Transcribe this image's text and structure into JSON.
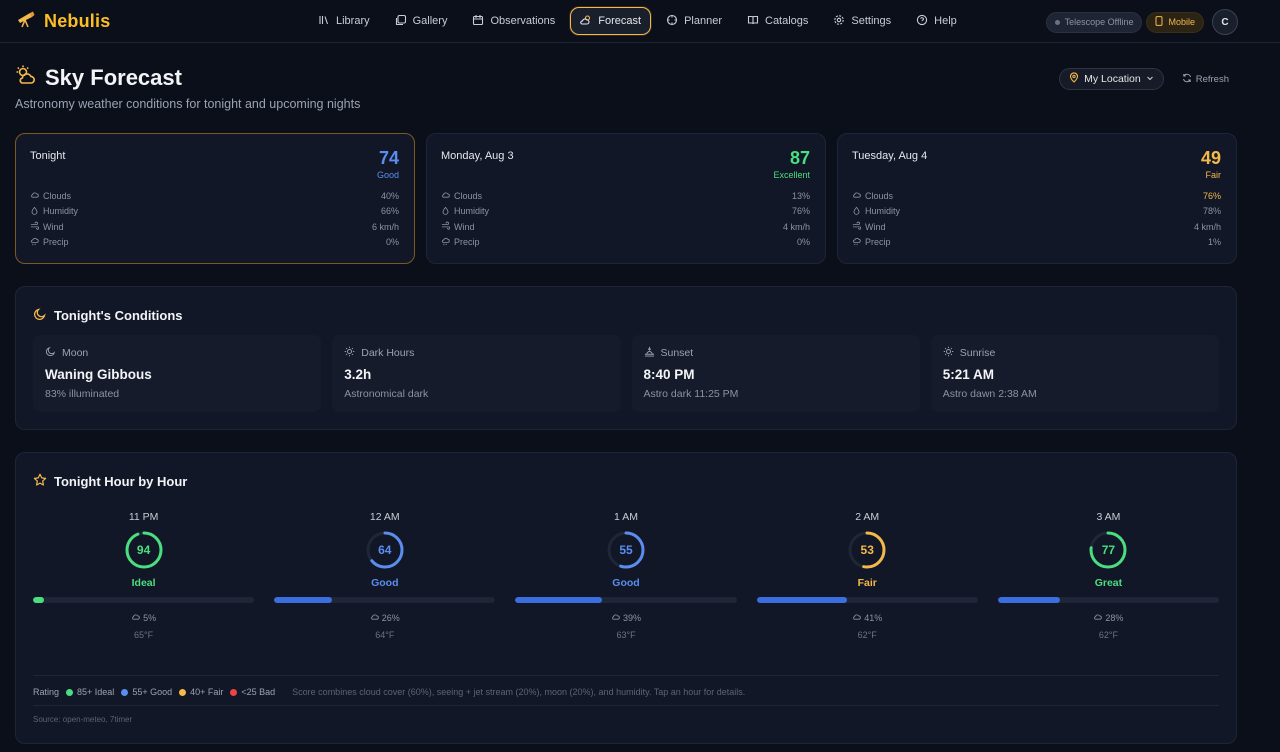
{
  "app": {
    "name": "Nebulis"
  },
  "nav": [
    {
      "label": "Library",
      "icon": "library-icon",
      "active": false
    },
    {
      "label": "Gallery",
      "icon": "gallery-icon",
      "active": false
    },
    {
      "label": "Observations",
      "icon": "calendar-icon",
      "active": false
    },
    {
      "label": "Forecast",
      "icon": "cloud-sun-icon",
      "active": true
    },
    {
      "label": "Planner",
      "icon": "planner-icon",
      "active": false
    },
    {
      "label": "Catalogs",
      "icon": "book-icon",
      "active": false
    },
    {
      "label": "Settings",
      "icon": "gear-icon",
      "active": false
    },
    {
      "label": "Help",
      "icon": "help-icon",
      "active": false
    }
  ],
  "status": {
    "telescope": "Telescope Offline",
    "device": "Mobile",
    "avatar": "C"
  },
  "page": {
    "title": "Sky Forecast",
    "subtitle": "Astronomy weather conditions for tonight and upcoming nights",
    "location_label": "My Location",
    "refresh_label": "Refresh"
  },
  "metric_labels": {
    "clouds": "Clouds",
    "humidity": "Humidity",
    "wind": "Wind",
    "precip": "Precip"
  },
  "days": [
    {
      "name": "Tonight",
      "score": "74",
      "rating": "Good",
      "color": "#5b8def",
      "clouds": "40%",
      "clouds_color": "#8b93a3",
      "humidity": "66%",
      "wind": "6 km/h",
      "precip": "0%"
    },
    {
      "name": "Monday, Aug 3",
      "score": "87",
      "rating": "Excellent",
      "color": "#4ade80",
      "clouds": "13%",
      "clouds_color": "#8b93a3",
      "humidity": "76%",
      "wind": "4 km/h",
      "precip": "0%"
    },
    {
      "name": "Tuesday, Aug 4",
      "score": "49",
      "rating": "Fair",
      "color": "#f5b94a",
      "clouds": "76%",
      "clouds_color": "#f5b94a",
      "humidity": "78%",
      "wind": "4 km/h",
      "precip": "1%"
    }
  ],
  "conditions": {
    "title": "Tonight's Conditions",
    "items": [
      {
        "label": "Moon",
        "icon": "moon-icon",
        "value": "Waning Gibbous",
        "sub": "83% illuminated"
      },
      {
        "label": "Dark Hours",
        "icon": "sun-icon",
        "value": "3.2h",
        "sub": "Astronomical dark"
      },
      {
        "label": "Sunset",
        "icon": "sunset-icon",
        "value": "8:40 PM",
        "sub": "Astro dark 11:25 PM"
      },
      {
        "label": "Sunrise",
        "icon": "sunrise-icon",
        "value": "5:21 AM",
        "sub": "Astro dawn 2:38 AM"
      }
    ]
  },
  "hourly": {
    "title": "Tonight Hour by Hour",
    "hours": [
      {
        "time": "11 PM",
        "score": 94,
        "score_text": "94",
        "label": "Ideal",
        "color": "#4ade80",
        "cloud": 5,
        "cloud_text": "5%",
        "temp": "65°F"
      },
      {
        "time": "12 AM",
        "score": 64,
        "score_text": "64",
        "label": "Good",
        "color": "#5b8def",
        "cloud": 26,
        "cloud_text": "26%",
        "temp": "64°F"
      },
      {
        "time": "1 AM",
        "score": 55,
        "score_text": "55",
        "label": "Good",
        "color": "#5b8def",
        "cloud": 39,
        "cloud_text": "39%",
        "temp": "63°F"
      },
      {
        "time": "2 AM",
        "score": 53,
        "score_text": "53",
        "label": "Fair",
        "color": "#f5b94a",
        "cloud": 41,
        "cloud_text": "41%",
        "temp": "62°F"
      },
      {
        "time": "3 AM",
        "score": 77,
        "score_text": "77",
        "label": "Great",
        "color": "#4ade80",
        "cloud": 28,
        "cloud_text": "28%",
        "temp": "62°F"
      }
    ],
    "legend_title": "Rating",
    "legend": [
      {
        "label": "85+ Ideal",
        "color": "#4ade80"
      },
      {
        "label": "55+ Good",
        "color": "#5b8def"
      },
      {
        "label": "40+ Fair",
        "color": "#f5b94a"
      },
      {
        "label": "<25 Bad",
        "color": "#ef4444"
      }
    ],
    "note": "Score combines cloud cover (60%), seeing + jet stream (20%), moon (20%), and humidity. Tap an hour for details.",
    "source": "Source: open-meteo, 7timer"
  },
  "colors": {
    "accent": "#fbbf24",
    "bar_day": "#4ade80",
    "bar_cloud": "#3b6fe0"
  }
}
